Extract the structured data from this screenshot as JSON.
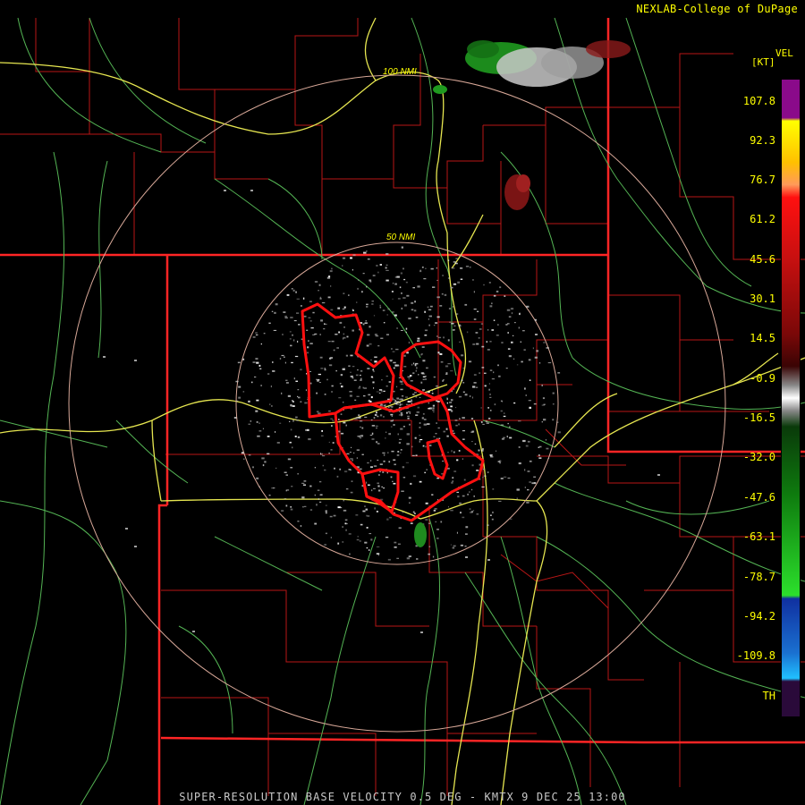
{
  "credit": "NEXLAB-College of DuPage",
  "product": "VEL",
  "units": "[KT]",
  "caption": "SUPER-RESOLUTION BASE VELOCITY 0.5 DEG - KMTX 9 DEC 25 13:00",
  "range_rings": [
    "100 NMI",
    "50 NMI"
  ],
  "colorbar": {
    "labels": [
      "107.8",
      "92.3",
      "76.7",
      "61.2",
      "45.6",
      "30.1",
      "14.5",
      "-0.9",
      "-16.5",
      "-32.0",
      "-47.6",
      "-63.1",
      "-78.7",
      "-94.2",
      "-109.8",
      "TH"
    ]
  },
  "colors": {
    "label_text": "#ffff00",
    "state_borders": "#ff2020",
    "county_borders": "#c01818",
    "highways": "#e8e850",
    "roads": "#60c060",
    "range_rings": "#e0b0a0",
    "warning_polygons": "#ff1010"
  }
}
